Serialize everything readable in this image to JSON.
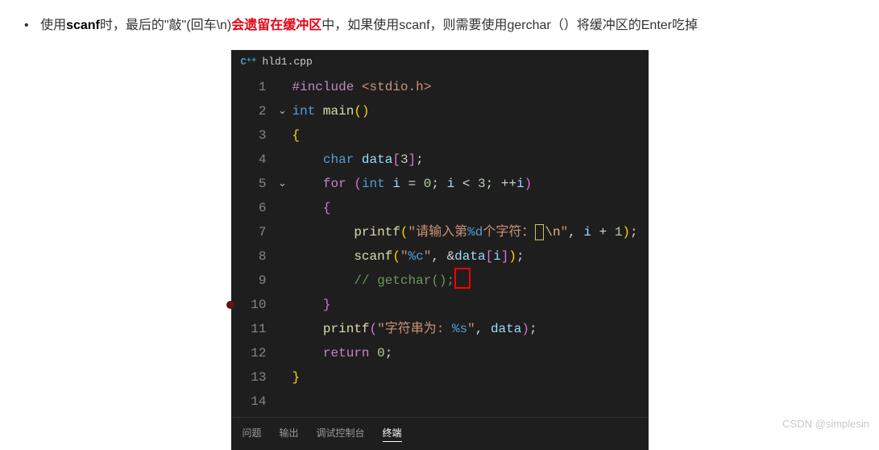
{
  "note": {
    "pre": "使用",
    "scanf": "scanf",
    "mid1": "时，最后的\"敲\"(回车\\n)",
    "red": "会遗留在缓冲区",
    "mid2": "中，如果使用scanf，则需要使用gerchar（）将缓冲区的Enter吃掉"
  },
  "tab": {
    "icon": "C⁺⁺",
    "filename": "hld1.cpp"
  },
  "fold": {
    "l2": "⌄",
    "l5": "⌄"
  },
  "code": {
    "l1": {
      "include": "#include",
      "hdr": "<stdio.h>"
    },
    "l2": {
      "t": "int",
      "fn": "main"
    },
    "l3": {
      "b": "{"
    },
    "l4": {
      "t": "char",
      "v": "data",
      "n": "3"
    },
    "l5": {
      "for": "for",
      "t": "int",
      "v": "i",
      "n0": "0",
      "n3": "3"
    },
    "l6": {
      "b": "{"
    },
    "l7": {
      "fn": "printf",
      "s1": "\"请输入第",
      "fmt": "%d",
      "s2": "个字符：",
      "esc": "\\n",
      "s3": "\"",
      "v": "i",
      "n1": "1"
    },
    "l8": {
      "fn": "scanf",
      "s": "\"%c\"",
      "v": "data",
      "vi": "i",
      "fmt": "%c"
    },
    "l9": {
      "c": "// getchar();"
    },
    "l10": {
      "b": "}"
    },
    "l11": {
      "fn": "printf",
      "s": "\"字符串为: ",
      "fmt": "%s",
      "s2": "\"",
      "v": "data"
    },
    "l12": {
      "ret": "return",
      "n": "0"
    },
    "l13": {
      "b": "}"
    }
  },
  "panel": {
    "problems": "问题",
    "output": "输出",
    "debug": "调试控制台",
    "terminal": "终端"
  },
  "watermark": "CSDN @simplesin"
}
